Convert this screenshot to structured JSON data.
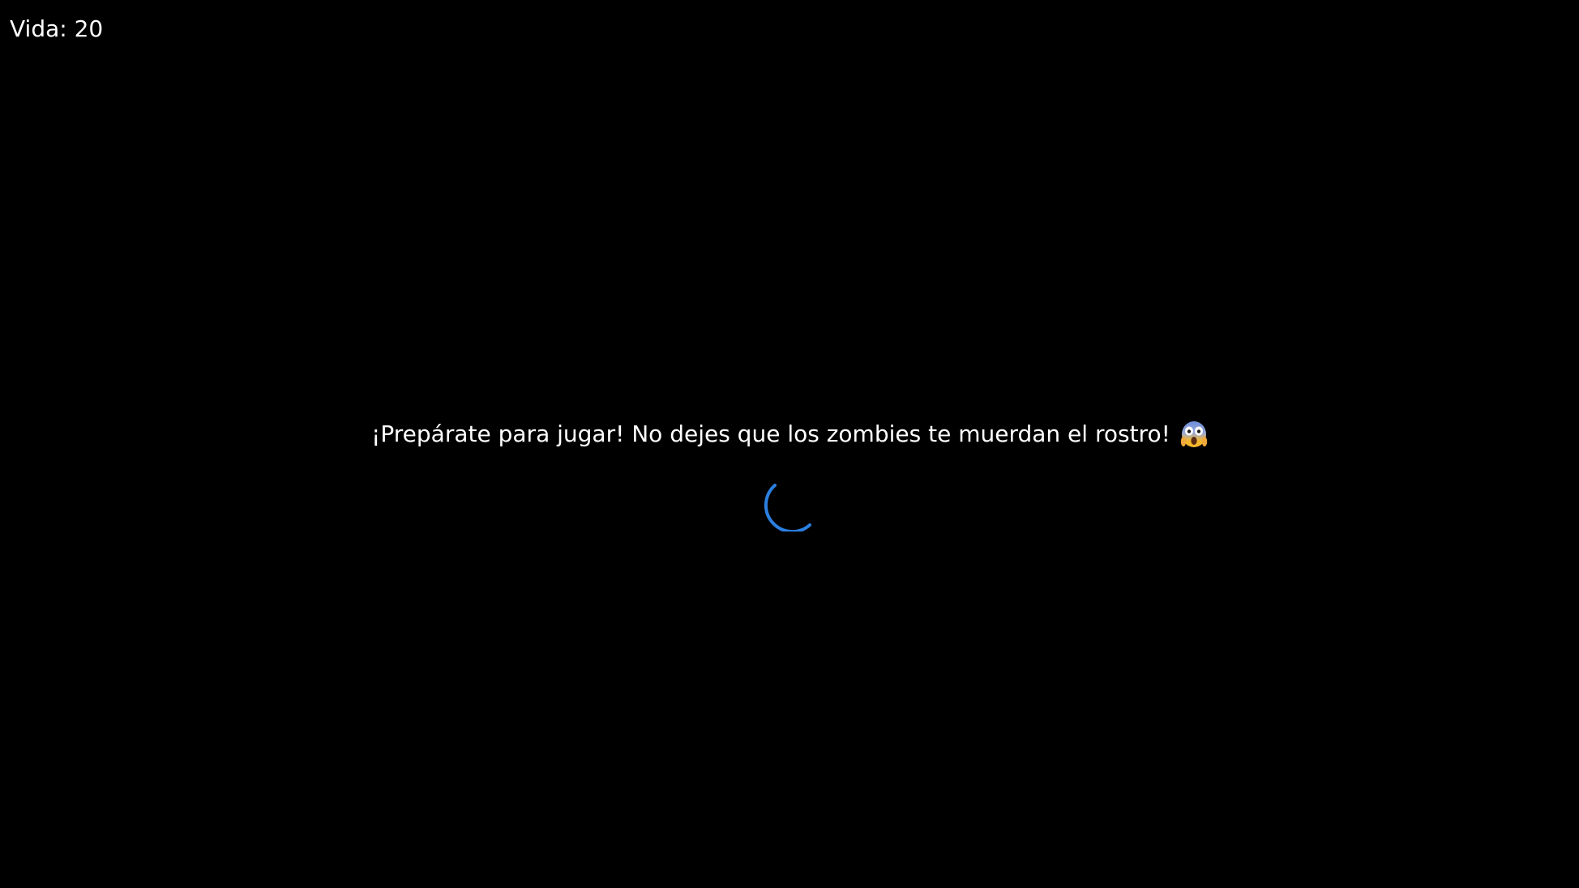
{
  "hud": {
    "life_text": "Vida: 20"
  },
  "loading": {
    "message": "¡Prepárate para jugar! No dejes que los zombies te muerdan el rostro!",
    "emoji_icon": "screaming-face-icon",
    "spinner_icon": "loading-spinner-icon"
  },
  "colors": {
    "background": "#000000",
    "text": "#ffffff",
    "spinner": "#2b7fe0",
    "emoji_face": "#f5b82e",
    "emoji_blue": "#6f8fdc"
  }
}
